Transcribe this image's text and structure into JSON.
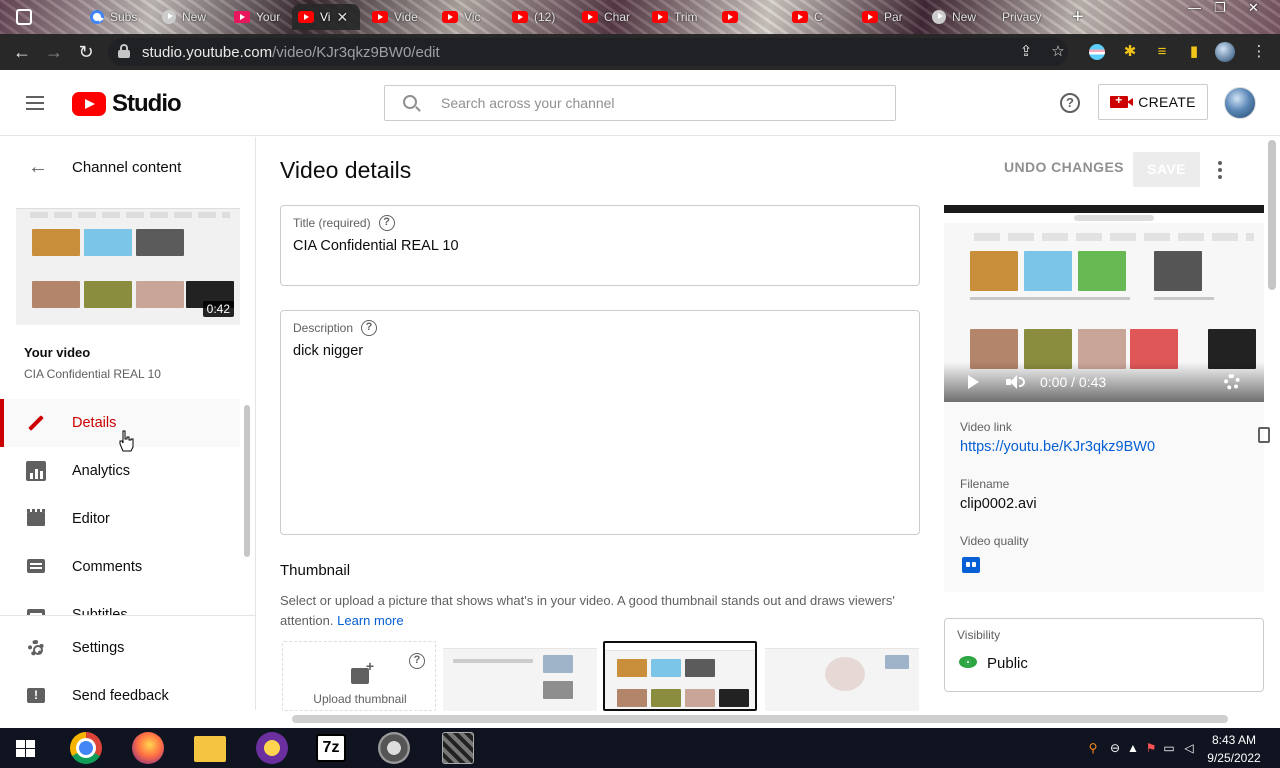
{
  "browser": {
    "tabs": [
      {
        "label": "Subs",
        "icon": "google-icon"
      },
      {
        "label": "New",
        "icon": "github-icon"
      },
      {
        "label": "Your",
        "icon": "download-icon"
      },
      {
        "label": "Vi",
        "icon": "youtube-icon",
        "active": true
      },
      {
        "label": "Vide",
        "icon": "youtube-icon"
      },
      {
        "label": "Vic",
        "icon": "youtube-icon"
      },
      {
        "label": "(12)",
        "icon": "youtube-icon"
      },
      {
        "label": "Char",
        "icon": "youtube-icon"
      },
      {
        "label": "Trim",
        "icon": "youtube-icon"
      },
      {
        "label": "",
        "icon": "youtube-icon"
      },
      {
        "label": "C",
        "icon": "youtube-icon"
      },
      {
        "label": "Par",
        "icon": "youtube-icon"
      },
      {
        "label": "New",
        "icon": "github-icon"
      },
      {
        "label": "Privacy",
        "icon": "page-icon"
      }
    ],
    "url_host": "studio.youtube.com",
    "url_path": "/video/KJr3qkz9BW0/edit"
  },
  "header": {
    "logo_text": "Studio",
    "search_placeholder": "Search across your channel",
    "create_label": "CREATE"
  },
  "sidebar": {
    "back_label": "Channel content",
    "thumb_duration": "0:42",
    "your_video_label": "Your video",
    "video_title": "CIA Confidential REAL 10",
    "items": [
      {
        "label": "Details",
        "icon": "pencil-icon",
        "active": true
      },
      {
        "label": "Analytics",
        "icon": "analytics-icon"
      },
      {
        "label": "Editor",
        "icon": "clapper-icon"
      },
      {
        "label": "Comments",
        "icon": "comment-icon"
      },
      {
        "label": "Subtitles",
        "icon": "subtitles-icon"
      }
    ],
    "settings_label": "Settings",
    "feedback_label": "Send feedback"
  },
  "main": {
    "page_title": "Video details",
    "undo_label": "UNDO CHANGES",
    "save_label": "SAVE",
    "title_label": "Title (required)",
    "title_value": "CIA Confidential REAL 10",
    "description_label": "Description",
    "description_value": "dick nigger",
    "thumbnail_heading": "Thumbnail",
    "thumbnail_desc": "Select or upload a picture that shows what's in your video. A good thumbnail stands out and draws viewers' attention.",
    "learn_more": "Learn more",
    "upload_thumbnail_label": "Upload thumbnail"
  },
  "right_panel": {
    "time_display": "0:00 / 0:43",
    "video_link_label": "Video link",
    "video_link": "https://youtu.be/KJr3qkz9BW0",
    "filename_label": "Filename",
    "filename": "clip0002.avi",
    "video_quality_label": "Video quality",
    "visibility_label": "Visibility",
    "visibility_value": "Public"
  },
  "taskbar": {
    "time": "8:43 AM",
    "date": "9/25/2022",
    "apps": [
      "windows-start",
      "chrome",
      "firefox",
      "file-explorer",
      "yahoo-messenger",
      "7zip",
      "media-player",
      "trojan-app"
    ],
    "seven_zip_label": "7z"
  },
  "colors": {
    "brand_red": "#ff0000",
    "active_red": "#cc0000",
    "link_blue": "#065fd4",
    "public_green": "#2ba640"
  }
}
